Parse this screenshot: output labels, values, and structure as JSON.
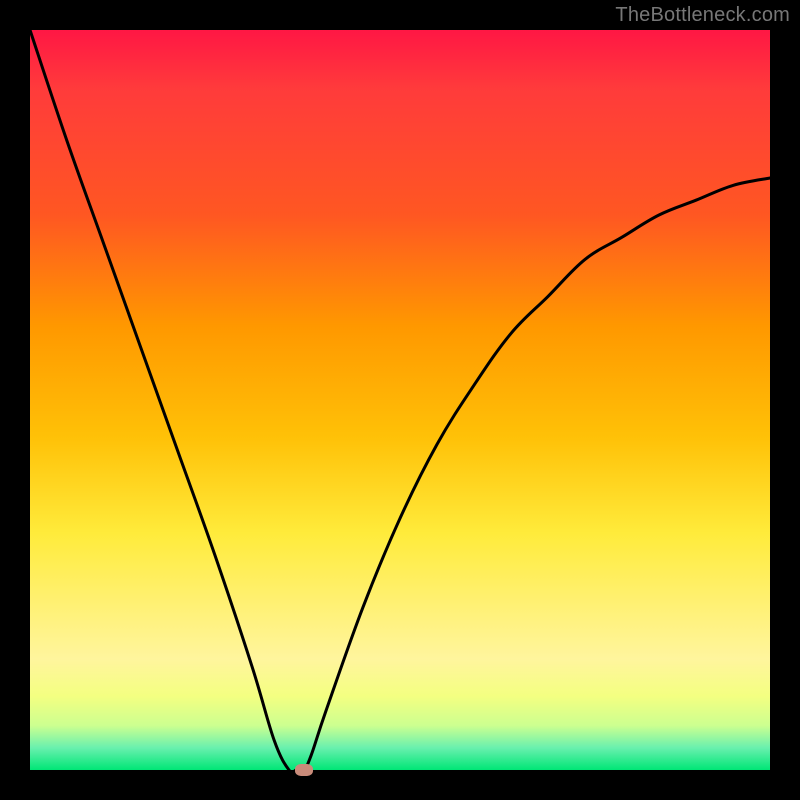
{
  "watermark": "TheBottleneck.com",
  "chart_data": {
    "type": "line",
    "title": "",
    "xlabel": "",
    "ylabel": "",
    "xlim": [
      0,
      100
    ],
    "ylim": [
      0,
      100
    ],
    "grid": false,
    "legend": false,
    "series": [
      {
        "name": "bottleneck-curve",
        "x": [
          0,
          5,
          10,
          15,
          20,
          25,
          30,
          33,
          35,
          36,
          37,
          38,
          40,
          45,
          50,
          55,
          60,
          65,
          70,
          75,
          80,
          85,
          90,
          95,
          100
        ],
        "y": [
          100,
          85,
          71,
          57,
          43,
          29,
          14,
          4,
          0,
          0,
          0,
          2,
          8,
          22,
          34,
          44,
          52,
          59,
          64,
          69,
          72,
          75,
          77,
          79,
          80
        ]
      }
    ],
    "marker": {
      "x_pct": 37,
      "y_pct": 0,
      "color": "#c98b7a"
    },
    "background_gradient": {
      "top": "#ff1744",
      "middle": "#ffeb3b",
      "bottom": "#00e676"
    }
  }
}
